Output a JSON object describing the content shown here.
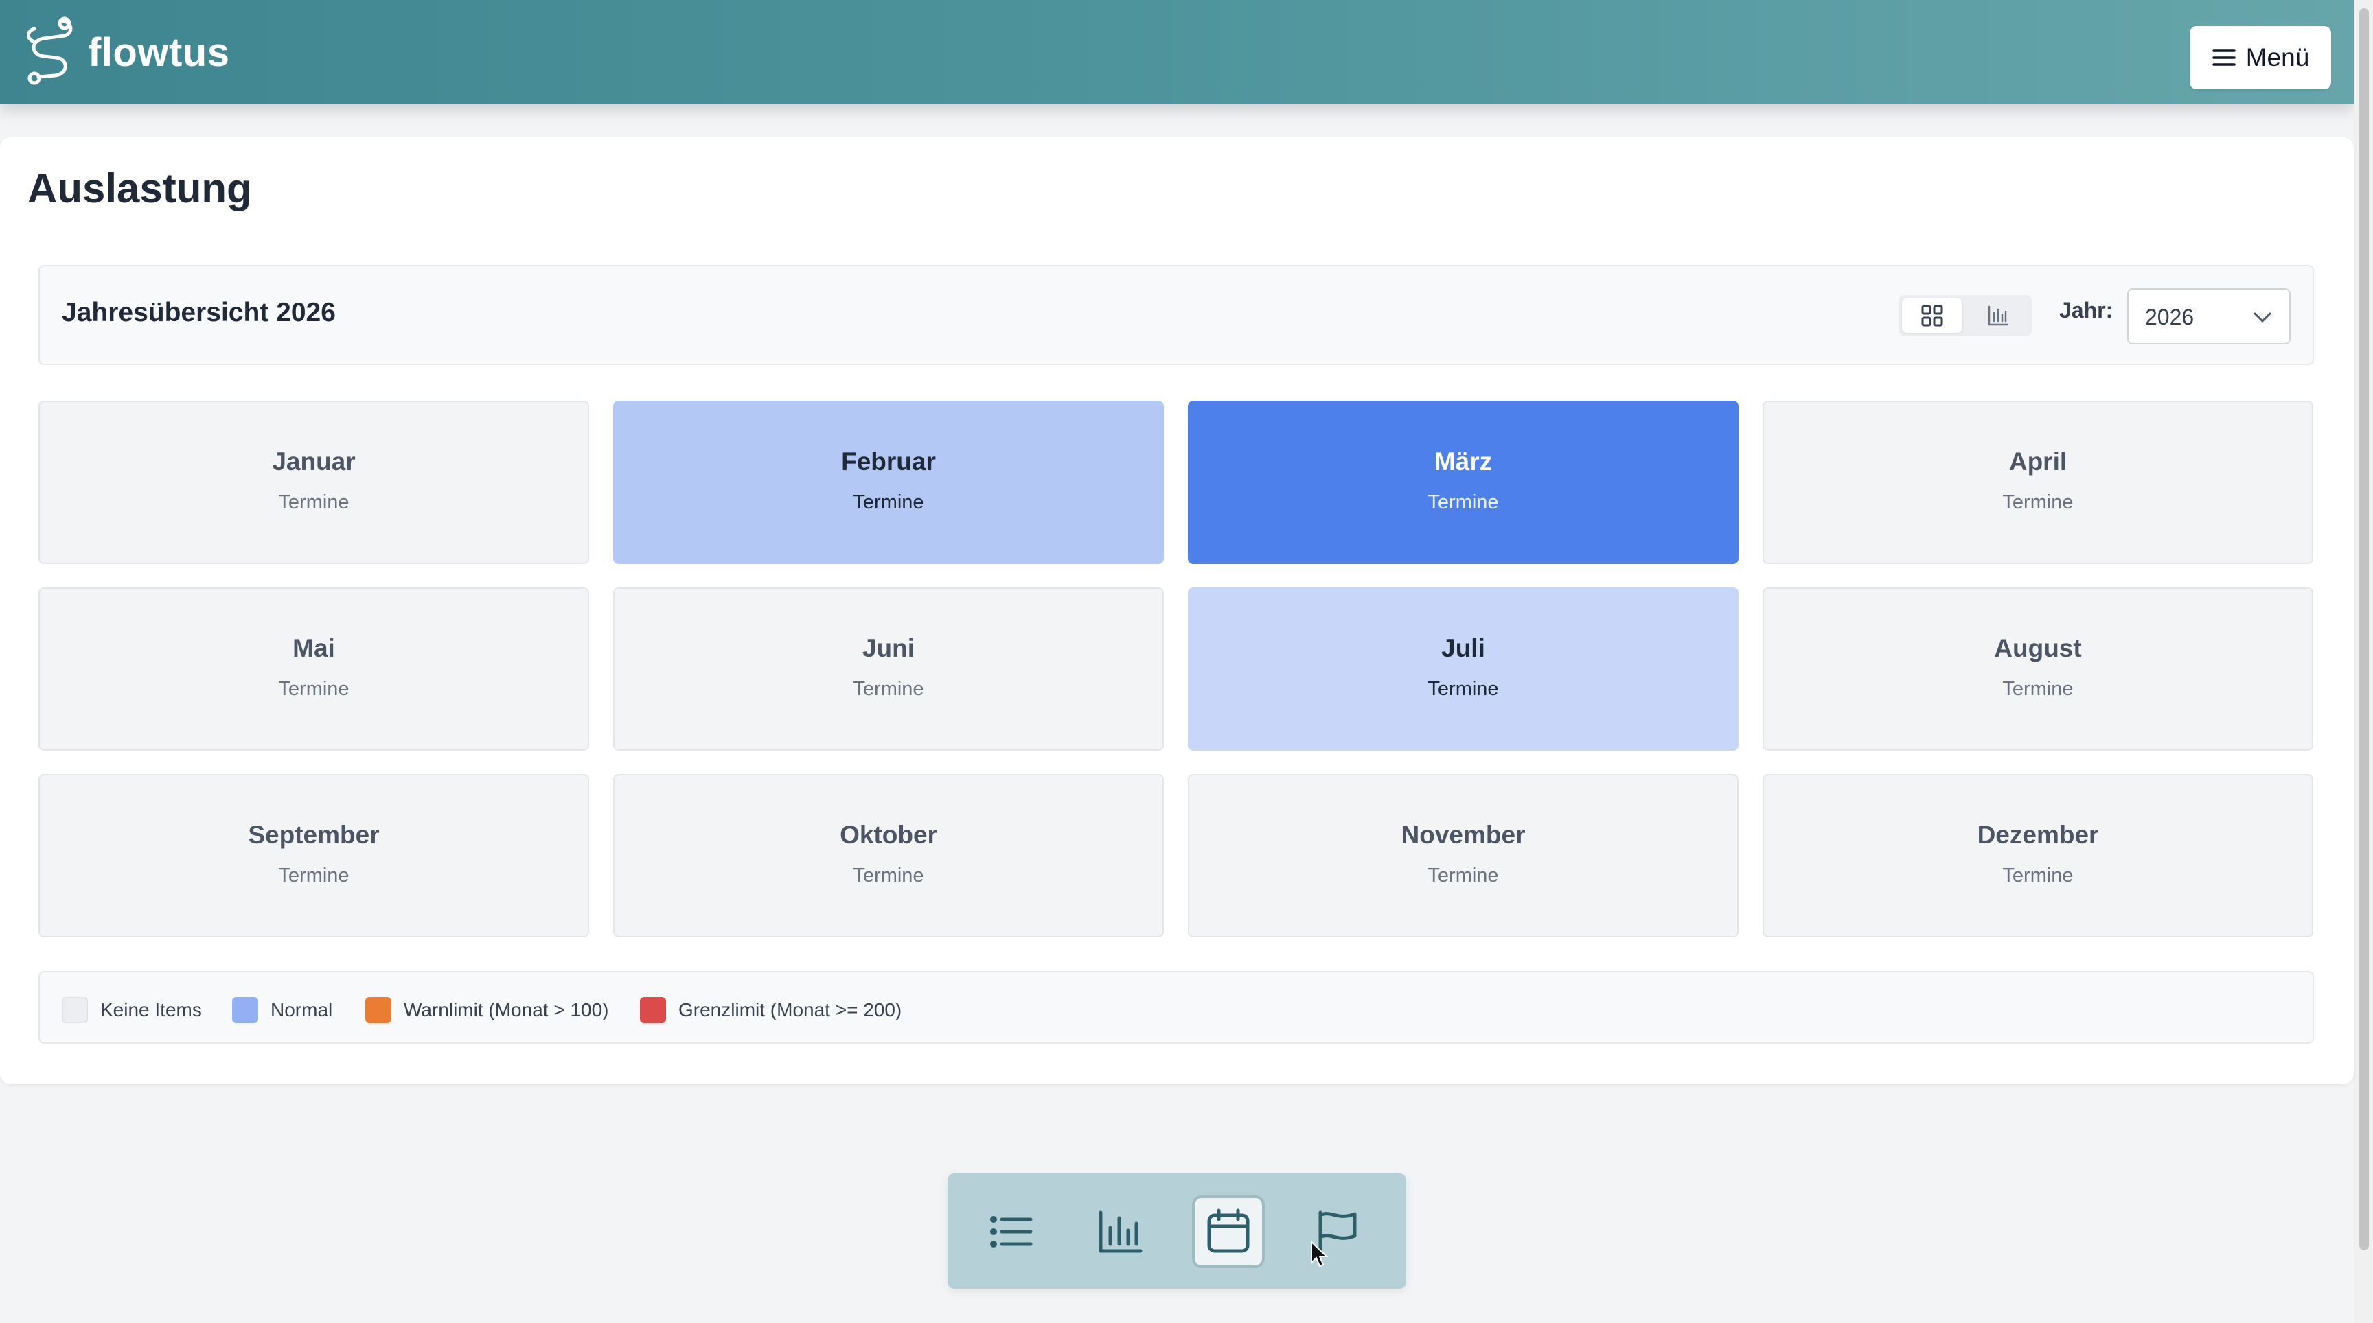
{
  "header": {
    "brand": "flowtus",
    "menu_label": "Menü"
  },
  "page": {
    "title": "Auslastung"
  },
  "overview": {
    "title": "Jahresübersicht 2026",
    "year_label": "Jahr:",
    "year_value": "2026"
  },
  "months": [
    {
      "name": "Januar",
      "sub": "Termine",
      "level": "none"
    },
    {
      "name": "Februar",
      "sub": "Termine",
      "level": "normal-light"
    },
    {
      "name": "März",
      "sub": "Termine",
      "level": "normal-strong"
    },
    {
      "name": "April",
      "sub": "Termine",
      "level": "none"
    },
    {
      "name": "Mai",
      "sub": "Termine",
      "level": "none"
    },
    {
      "name": "Juni",
      "sub": "Termine",
      "level": "none"
    },
    {
      "name": "Juli",
      "sub": "Termine",
      "level": "normal-lighter"
    },
    {
      "name": "August",
      "sub": "Termine",
      "level": "none"
    },
    {
      "name": "September",
      "sub": "Termine",
      "level": "none"
    },
    {
      "name": "Oktober",
      "sub": "Termine",
      "level": "none"
    },
    {
      "name": "November",
      "sub": "Termine",
      "level": "none"
    },
    {
      "name": "Dezember",
      "sub": "Termine",
      "level": "none"
    }
  ],
  "legend": [
    {
      "label": "Keine Items",
      "color": "#eceef1"
    },
    {
      "label": "Normal",
      "color": "#93b0f3"
    },
    {
      "label": "Warnlimit (Monat > 100)",
      "color": "#ea7d33"
    },
    {
      "label": "Grenzlimit (Monat >= 200)",
      "color": "#dc4b4b"
    }
  ],
  "icons": {
    "logo": "flowtus-logo-icon",
    "menu": "hamburger-icon",
    "grid_view": "grid-icon",
    "chart_view": "bar-chart-icon",
    "select": "chevron-down-icon",
    "nav": [
      "list-icon",
      "bar-chart-icon",
      "calendar-icon",
      "flag-icon"
    ]
  },
  "colors": {
    "header_start": "#3f8590",
    "header_end": "#66a6ab",
    "accent": "#4d80eb",
    "nav_bg": "#b5d0d6"
  }
}
